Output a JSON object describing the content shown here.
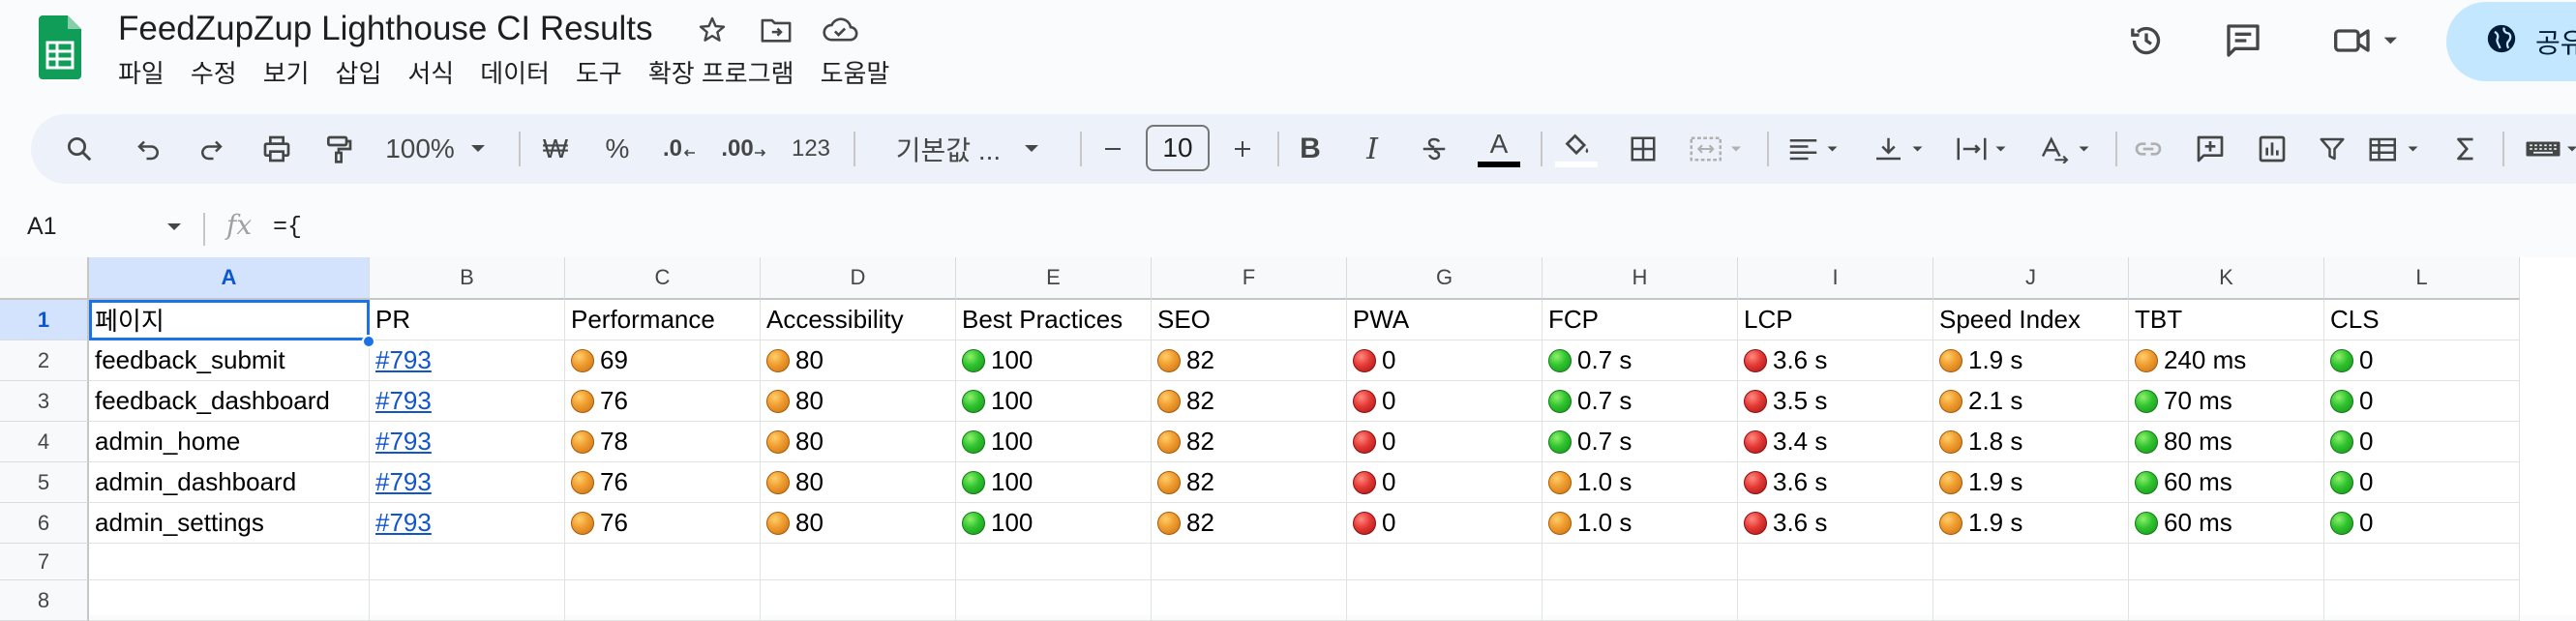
{
  "app": {
    "title": "FeedZupZup Lighthouse CI Results",
    "menu": [
      "파일",
      "수정",
      "보기",
      "삽입",
      "서식",
      "데이터",
      "도구",
      "확장 프로그램",
      "도움말"
    ],
    "share_label": "공유",
    "accent_color": "#0b57d0"
  },
  "toolbar": {
    "zoom": "100%",
    "currency": "₩",
    "percent": "%",
    "dec_decrease": ".0",
    "dec_increase": ".00",
    "number_format": "123",
    "font": "기본값 ...",
    "font_size": "10",
    "bold": "B",
    "italic": "I",
    "text_color": "A"
  },
  "formula_bar": {
    "cell_ref": "A1",
    "fx": "fx",
    "formula": "={"
  },
  "grid": {
    "columns": [
      "A",
      "B",
      "C",
      "D",
      "E",
      "F",
      "G",
      "H",
      "I",
      "J",
      "K",
      "L"
    ],
    "rows": [
      "1",
      "2",
      "3",
      "4",
      "5",
      "6",
      "7",
      "8"
    ],
    "header": [
      "페이지",
      "PR",
      "Performance",
      "Accessibility",
      "Best Practices",
      "SEO",
      "PWA",
      "FCP",
      "LCP",
      "Speed Index",
      "TBT",
      "CLS"
    ],
    "data": [
      [
        {
          "t": "feedback_submit"
        },
        {
          "t": "#793",
          "link": true
        },
        {
          "t": "69",
          "s": "orange"
        },
        {
          "t": "80",
          "s": "orange"
        },
        {
          "t": "100",
          "s": "green"
        },
        {
          "t": "82",
          "s": "orange"
        },
        {
          "t": "0",
          "s": "red"
        },
        {
          "t": "0.7 s",
          "s": "green"
        },
        {
          "t": "3.6 s",
          "s": "red"
        },
        {
          "t": "1.9 s",
          "s": "orange"
        },
        {
          "t": "240 ms",
          "s": "orange"
        },
        {
          "t": "0",
          "s": "green"
        }
      ],
      [
        {
          "t": "feedback_dashboard"
        },
        {
          "t": "#793",
          "link": true
        },
        {
          "t": "76",
          "s": "orange"
        },
        {
          "t": "80",
          "s": "orange"
        },
        {
          "t": "100",
          "s": "green"
        },
        {
          "t": "82",
          "s": "orange"
        },
        {
          "t": "0",
          "s": "red"
        },
        {
          "t": "0.7 s",
          "s": "green"
        },
        {
          "t": "3.5 s",
          "s": "red"
        },
        {
          "t": "2.1 s",
          "s": "orange"
        },
        {
          "t": "70 ms",
          "s": "green"
        },
        {
          "t": "0",
          "s": "green"
        }
      ],
      [
        {
          "t": "admin_home"
        },
        {
          "t": "#793",
          "link": true
        },
        {
          "t": "78",
          "s": "orange"
        },
        {
          "t": "80",
          "s": "orange"
        },
        {
          "t": "100",
          "s": "green"
        },
        {
          "t": "82",
          "s": "orange"
        },
        {
          "t": "0",
          "s": "red"
        },
        {
          "t": "0.7 s",
          "s": "green"
        },
        {
          "t": "3.4 s",
          "s": "red"
        },
        {
          "t": "1.8 s",
          "s": "orange"
        },
        {
          "t": "80 ms",
          "s": "green"
        },
        {
          "t": "0",
          "s": "green"
        }
      ],
      [
        {
          "t": "admin_dashboard"
        },
        {
          "t": "#793",
          "link": true
        },
        {
          "t": "76",
          "s": "orange"
        },
        {
          "t": "80",
          "s": "orange"
        },
        {
          "t": "100",
          "s": "green"
        },
        {
          "t": "82",
          "s": "orange"
        },
        {
          "t": "0",
          "s": "red"
        },
        {
          "t": "1.0 s",
          "s": "orange"
        },
        {
          "t": "3.6 s",
          "s": "red"
        },
        {
          "t": "1.9 s",
          "s": "orange"
        },
        {
          "t": "60 ms",
          "s": "green"
        },
        {
          "t": "0",
          "s": "green"
        }
      ],
      [
        {
          "t": "admin_settings"
        },
        {
          "t": "#793",
          "link": true
        },
        {
          "t": "76",
          "s": "orange"
        },
        {
          "t": "80",
          "s": "orange"
        },
        {
          "t": "100",
          "s": "green"
        },
        {
          "t": "82",
          "s": "orange"
        },
        {
          "t": "0",
          "s": "red"
        },
        {
          "t": "1.0 s",
          "s": "orange"
        },
        {
          "t": "3.6 s",
          "s": "red"
        },
        {
          "t": "1.9 s",
          "s": "orange"
        },
        {
          "t": "60 ms",
          "s": "green"
        },
        {
          "t": "0",
          "s": "green"
        }
      ]
    ]
  }
}
